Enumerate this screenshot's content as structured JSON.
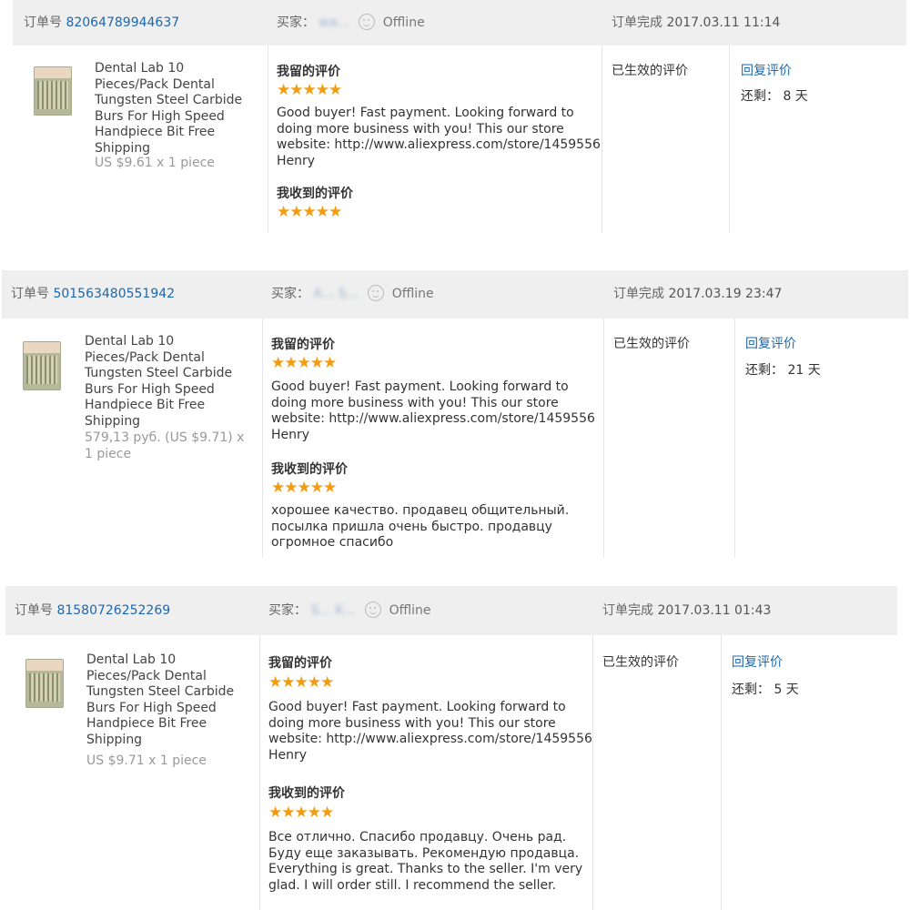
{
  "labels": {
    "order_no": "订单号",
    "buyer": "买家：",
    "offline": "Offline",
    "completed": "订单完成",
    "my_review": "我留的评价",
    "received_review": "我收到的评价",
    "effective": "已生效的评价",
    "reply": "回复评价",
    "remaining_prefix": "还剩："
  },
  "icons": {
    "status": "smiley-face-icon",
    "star": "star-icon",
    "thumbnail": "product-thumbnail-icon"
  },
  "colors": {
    "link": "#1c67ad",
    "star": "#f39c12",
    "header_bg": "#efefef"
  },
  "orders": [
    {
      "order_id": "82064789944637",
      "buyer_name": "wa...",
      "completed_at": "2017.03.11 11:14",
      "product_title": "Dental Lab 10 Pieces/Pack Dental Tungsten Steel Carbide Burs For High Speed Handpiece Bit Free Shipping",
      "price": "US $9.61 x 1 piece",
      "my_rating": 5,
      "my_text": "Good buyer! Fast payment. Looking forward to doing more business with you! This our store website: http://www.aliexpress.com/store/1459556 Henry",
      "received_rating": 5,
      "received_text": "",
      "remaining": "8 天"
    },
    {
      "order_id": "501563480551942",
      "buyer_name": "A... S...",
      "completed_at": "2017.03.19 23:47",
      "product_title": "Dental Lab 10 Pieces/Pack Dental Tungsten Steel Carbide Burs For High Speed Handpiece Bit Free Shipping",
      "price": "579,13 руб. (US $9.71) x 1 piece",
      "my_rating": 5,
      "my_text": "Good buyer! Fast payment. Looking forward to doing more business with you! This our store website: http://www.aliexpress.com/store/1459556 Henry",
      "received_rating": 5,
      "received_text": "хорошее качество. продавец общительный. посылка пришла очень быстро. продавцу огромное спасибо",
      "remaining": "21 天"
    },
    {
      "order_id": "81580726252269",
      "buyer_name": "S... K...",
      "completed_at": "2017.03.11 01:43",
      "product_title": "Dental Lab 10 Pieces/Pack Dental Tungsten Steel Carbide Burs For High Speed Handpiece Bit Free Shipping",
      "price": "US $9.71 x 1 piece",
      "my_rating": 5,
      "my_text": "Good buyer! Fast payment. Looking forward to doing more business with you! This our store website: http://www.aliexpress.com/store/1459556 Henry",
      "received_rating": 5,
      "received_text": "Все отлично. Спасибо продавцу. Очень рад. Буду еще заказывать. Рекомендую продавца. Everything is great. Thanks to the seller. I'm very glad. I will order still. I recommend the seller.",
      "remaining": "5 天"
    }
  ]
}
